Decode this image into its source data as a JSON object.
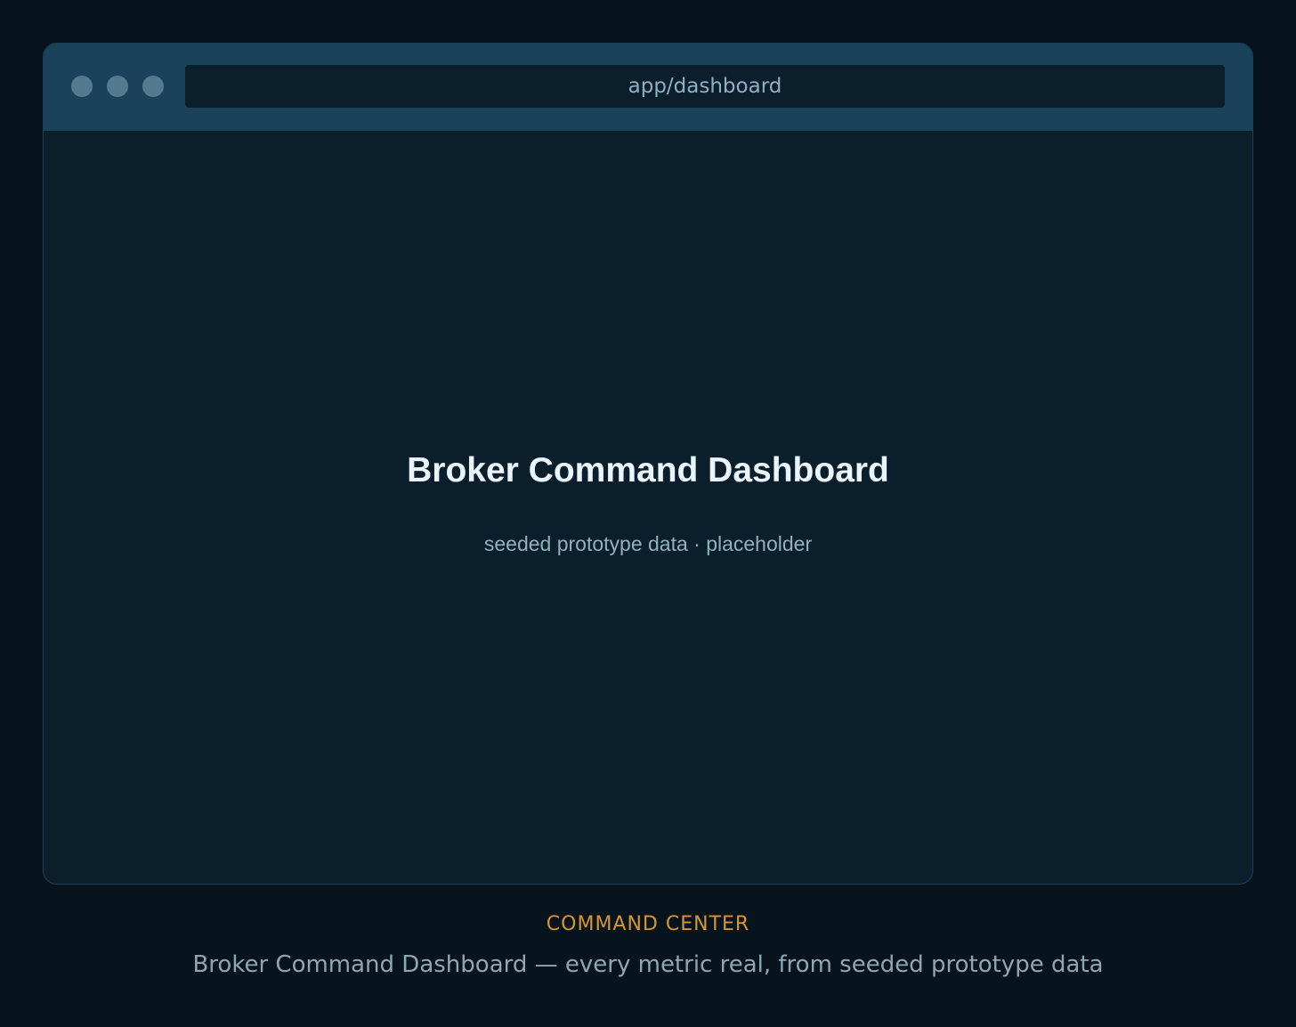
{
  "window": {
    "address": "app/dashboard",
    "controls": [
      "close-dot",
      "minimize-dot",
      "maximize-dot"
    ]
  },
  "main": {
    "title": "Broker Command Dashboard",
    "subtitle": "seeded prototype data · placeholder"
  },
  "caption": {
    "label": "COMMAND CENTER",
    "text": "Broker Command Dashboard — every metric real, from seeded prototype data"
  },
  "colors": {
    "background": "#08141d",
    "window": "#0b1e2c",
    "titlebar": "#1a425a",
    "accent": "#d6962f"
  }
}
